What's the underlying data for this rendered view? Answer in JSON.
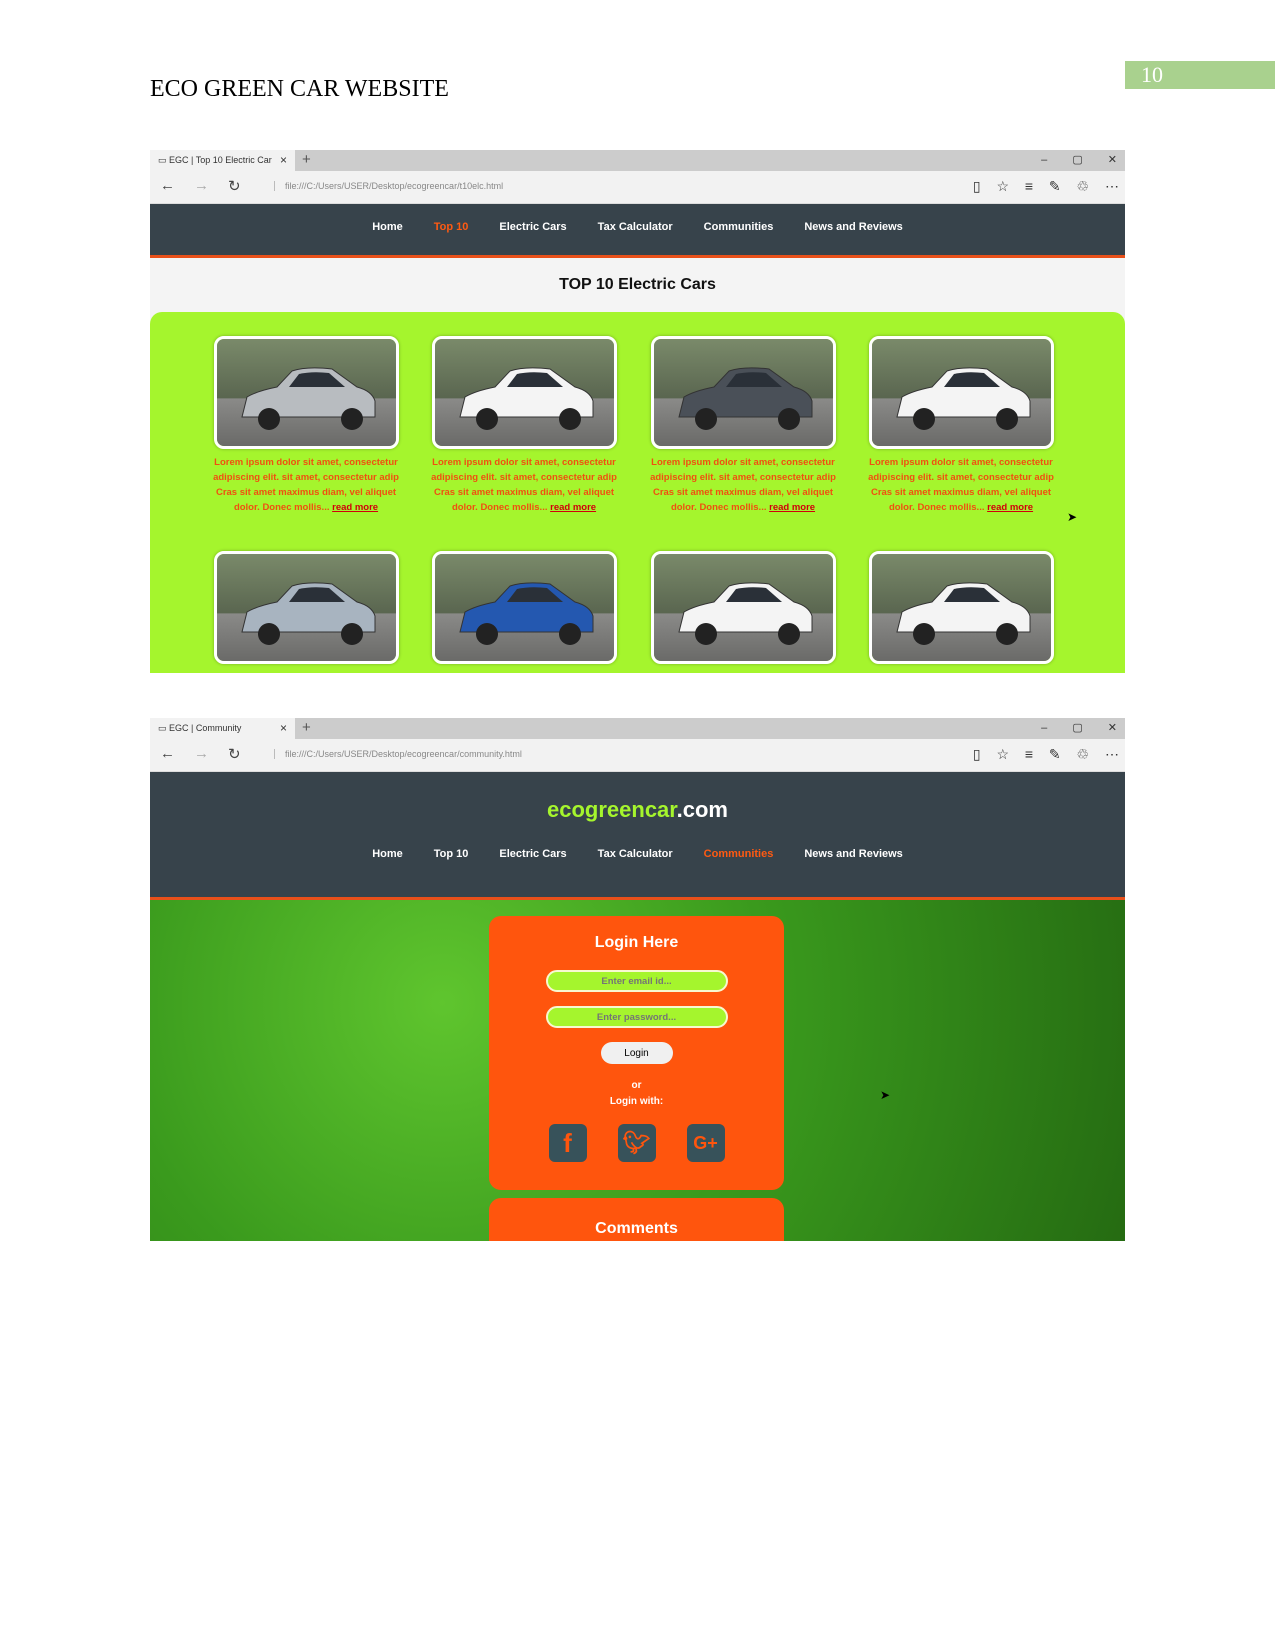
{
  "document": {
    "title": "ECO GREEN CAR WEBSITE",
    "page_number": "10"
  },
  "window1": {
    "tab_title": "EGC | Top 10 Electric Car",
    "url": "file:///C:/Users/USER/Desktop/ecogreencar/t10elc.html",
    "nav": [
      "Home",
      "Top 10",
      "Electric Cars",
      "Tax Calculator",
      "Communities",
      "News and Reviews"
    ],
    "active_nav": "Top 10",
    "page_title": "TOP 10 Electric Cars",
    "card_text": "Lorem ipsum dolor sit amet, consectetur adipiscing elit. sit amet, consectetur adip Cras sit amet maximus diam, vel aliquet dolor. Donec mollis...",
    "read_more": "read more",
    "cars_row1": [
      "silver",
      "white",
      "darkgray",
      "white"
    ],
    "cars_row2": [
      "silver-blue",
      "blue",
      "white",
      "white"
    ]
  },
  "window2": {
    "tab_title": "EGC | Community",
    "url": "file:///C:/Users/USER/Desktop/ecogreencar/community.html",
    "logo_green": "ecogreencar",
    "logo_white": ".com",
    "nav": [
      "Home",
      "Top 10",
      "Electric Cars",
      "Tax Calculator",
      "Communities",
      "News and Reviews"
    ],
    "active_nav": "Communities",
    "login": {
      "title": "Login Here",
      "email_placeholder": "Enter email id...",
      "password_placeholder": "Enter password...",
      "button": "Login",
      "or": "or",
      "login_with": "Login with:"
    },
    "social": [
      "facebook-icon",
      "twitter-icon",
      "google-plus-icon"
    ],
    "comments_title": "Comments"
  },
  "colors": {
    "nav_bg": "#37434b",
    "accent_orange": "#ff550d",
    "lime": "#a5f52d",
    "page_number_bg": "#a9d18e"
  }
}
